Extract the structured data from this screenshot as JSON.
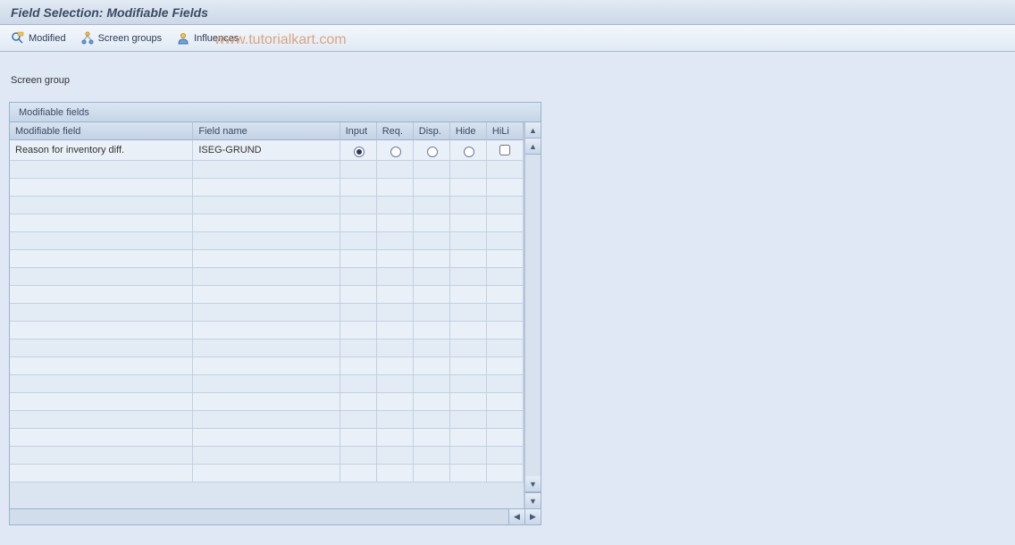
{
  "title": "Field Selection: Modifiable Fields",
  "toolbar": {
    "modified": "Modified",
    "screen_groups": "Screen groups",
    "influences": "Influences"
  },
  "watermark": "www.tutorialkart.com",
  "screen_group_label": "Screen group",
  "panel": {
    "title": "Modifiable fields",
    "columns": {
      "modifiable_field": "Modifiable field",
      "field_name": "Field name",
      "input": "Input",
      "req": "Req.",
      "disp": "Disp.",
      "hide": "Hide",
      "hili": "HiLi"
    },
    "rows": [
      {
        "modifiable_field": "Reason for inventory diff.",
        "field_name": "ISEG-GRUND",
        "selected": "input",
        "hili": false
      }
    ],
    "empty_row_count": 18
  }
}
